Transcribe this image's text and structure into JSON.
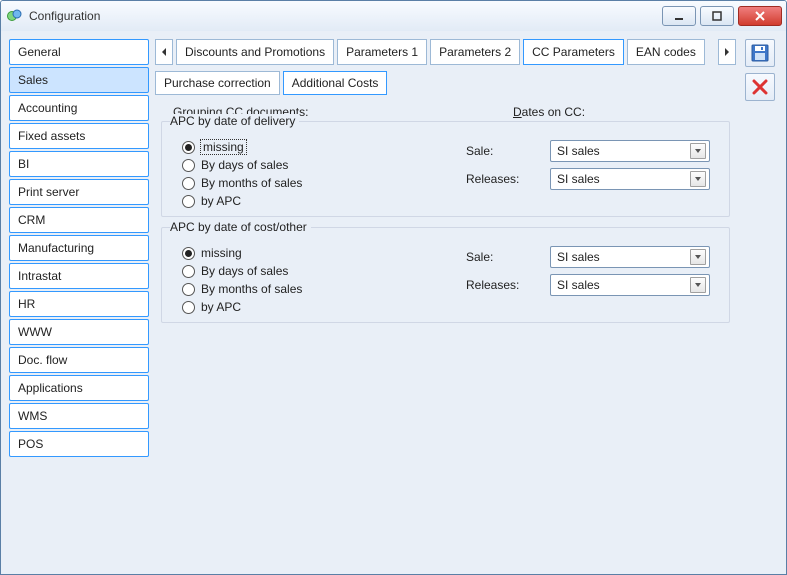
{
  "window": {
    "title": "Configuration"
  },
  "sidebar": {
    "items": [
      {
        "label": "General",
        "selected": false
      },
      {
        "label": "Sales",
        "selected": true
      },
      {
        "label": "Accounting",
        "selected": false
      },
      {
        "label": "Fixed assets",
        "selected": false
      },
      {
        "label": "BI",
        "selected": false
      },
      {
        "label": "Print server",
        "selected": false
      },
      {
        "label": "CRM",
        "selected": false
      },
      {
        "label": "Manufacturing",
        "selected": false
      },
      {
        "label": "Intrastat",
        "selected": false
      },
      {
        "label": "HR",
        "selected": false
      },
      {
        "label": "WWW",
        "selected": false
      },
      {
        "label": "Doc. flow",
        "selected": false
      },
      {
        "label": "Applications",
        "selected": false
      },
      {
        "label": "WMS",
        "selected": false
      },
      {
        "label": "POS",
        "selected": false
      }
    ]
  },
  "tabs": {
    "top": [
      {
        "label": "Discounts and Promotions",
        "active": false
      },
      {
        "label": "Parameters 1",
        "active": false
      },
      {
        "label": "Parameters 2",
        "active": false
      },
      {
        "label": "CC Parameters",
        "active": true
      },
      {
        "label": "EAN codes",
        "active": false
      }
    ],
    "sub": [
      {
        "label": "Purchase correction",
        "active": false
      },
      {
        "label": "Additional Costs",
        "active": true
      }
    ]
  },
  "toolbar": {
    "save_icon": "save-icon",
    "close_icon": "close-icon"
  },
  "headers": {
    "grouping_prefix": "G",
    "grouping_rest": "rouping CC documents:",
    "dates_prefix": "D",
    "dates_rest": "ates on CC:"
  },
  "groups": [
    {
      "legend": "APC by date of delivery",
      "radios": [
        {
          "label": "missing",
          "checked": true,
          "focused": true
        },
        {
          "label": "By days of sales",
          "checked": false,
          "focused": false
        },
        {
          "label": "By months of sales",
          "checked": false,
          "focused": false
        },
        {
          "label": "by APC",
          "checked": false,
          "focused": false
        }
      ],
      "fields": [
        {
          "label": "Sale:",
          "value": "SI sales"
        },
        {
          "label": "Releases:",
          "value": "SI sales"
        }
      ]
    },
    {
      "legend": "APC by date of cost/other",
      "radios": [
        {
          "label": "missing",
          "checked": true,
          "focused": false
        },
        {
          "label": "By days of sales",
          "checked": false,
          "focused": false
        },
        {
          "label": "By months of sales",
          "checked": false,
          "focused": false
        },
        {
          "label": "by APC",
          "checked": false,
          "focused": false
        }
      ],
      "fields": [
        {
          "label": "Sale:",
          "value": "SI sales"
        },
        {
          "label": "Releases:",
          "value": "SI sales"
        }
      ]
    }
  ]
}
